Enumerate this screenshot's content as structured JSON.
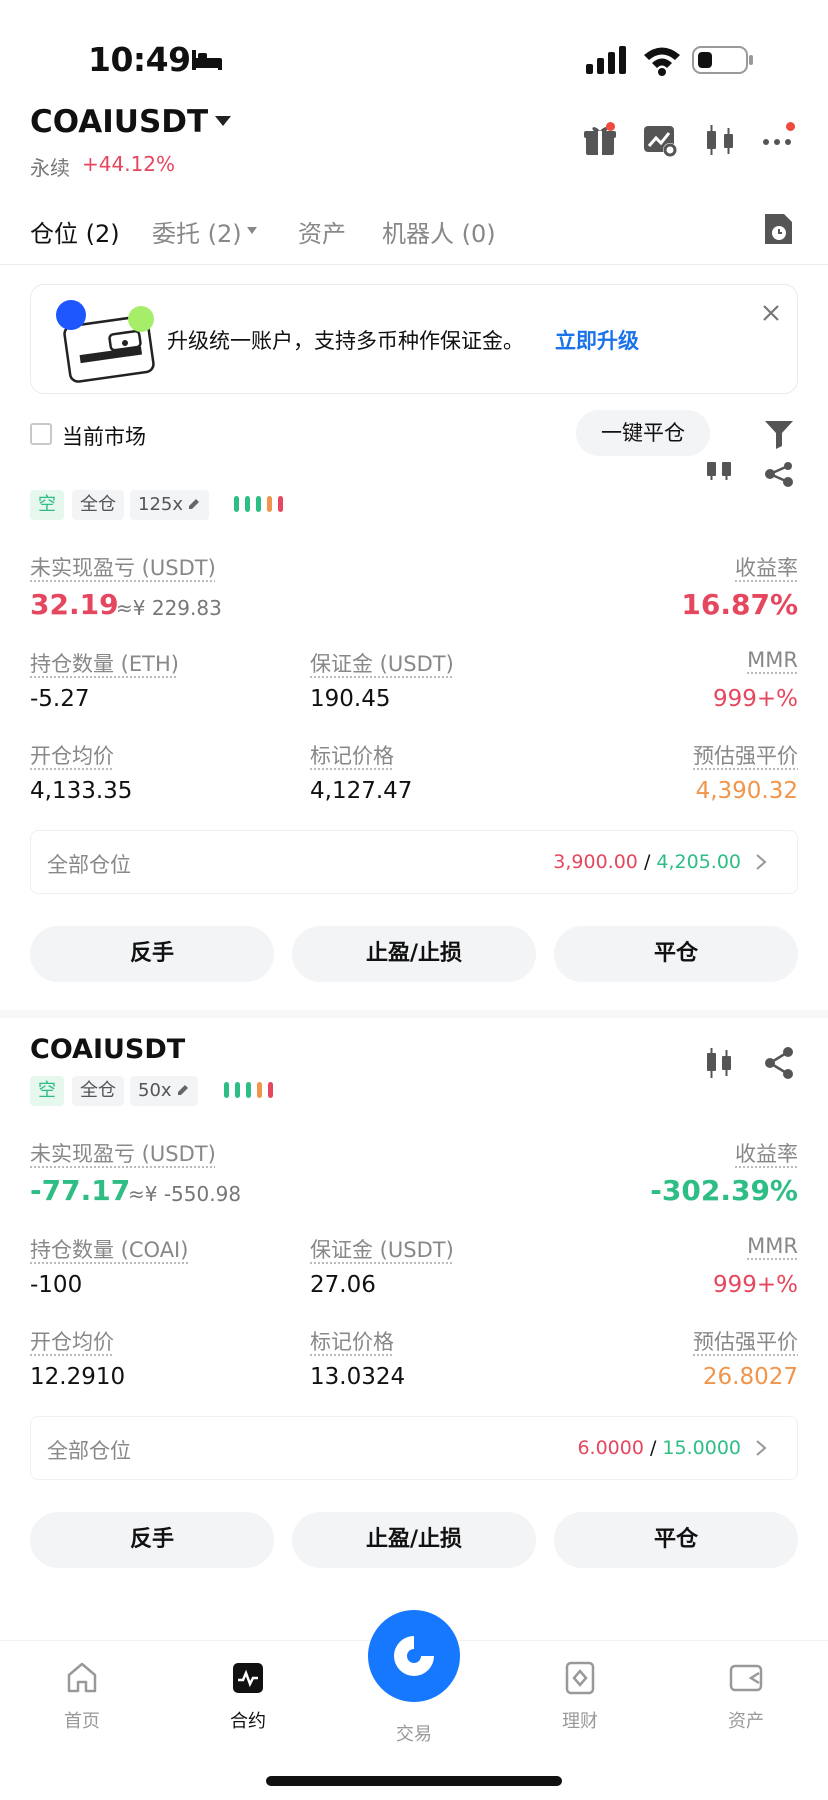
{
  "status_bar": {
    "time": "10:49"
  },
  "header": {
    "symbol": "COAIUSDT",
    "contract_type": "永续",
    "change": "+44.12%"
  },
  "tabs": [
    {
      "label": "仓位 (2)"
    },
    {
      "label": "委托 (2)"
    },
    {
      "label": "资产"
    },
    {
      "label": "机器人 (0)"
    }
  ],
  "banner": {
    "text": "升级统一账户，支持多币种作保证金。",
    "link": "立即升级"
  },
  "filter": {
    "current_market_label": "当前市场",
    "close_all_label": "一键平仓"
  },
  "positions": [
    {
      "title": "",
      "side": "空",
      "margin_mode": "全仓",
      "leverage": "125x",
      "pnl_label": "未实现盈亏 (USDT)",
      "pnl": "32.19",
      "pnl_cny": "≈¥ 229.83",
      "roi_label": "收益率",
      "roi": "16.87%",
      "qty_label": "持仓数量 (ETH)",
      "qty": "-5.27",
      "margin_label": "保证金 (USDT)",
      "margin": "190.45",
      "mmr_label": "MMR",
      "mmr": "999+%",
      "entry_label": "开仓均价",
      "entry": "4,133.35",
      "mark_label": "标记价格",
      "mark": "4,127.47",
      "liq_label": "预估强平价",
      "liq": "4,390.32",
      "tpsl_label": "全部仓位",
      "tp": "3,900.00",
      "sl": "4,205.00",
      "sep": "/",
      "btn_reverse": "反手",
      "btn_tpsl": "止盈/止损",
      "btn_close": "平仓",
      "pnl_color": "#e5475e"
    },
    {
      "title": "COAIUSDT",
      "side": "空",
      "margin_mode": "全仓",
      "leverage": "50x",
      "pnl_label": "未实现盈亏 (USDT)",
      "pnl": "-77.17",
      "pnl_cny": "≈¥ -550.98",
      "roi_label": "收益率",
      "roi": "-302.39%",
      "qty_label": "持仓数量 (COAI)",
      "qty": "-100",
      "margin_label": "保证金 (USDT)",
      "margin": "27.06",
      "mmr_label": "MMR",
      "mmr": "999+%",
      "entry_label": "开仓均价",
      "entry": "12.2910",
      "mark_label": "标记价格",
      "mark": "13.0324",
      "liq_label": "预估强平价",
      "liq": "26.8027",
      "tpsl_label": "全部仓位",
      "tp": "6.0000",
      "sl": "15.0000",
      "sep": "/",
      "btn_reverse": "反手",
      "btn_tpsl": "止盈/止损",
      "btn_close": "平仓",
      "pnl_color": "#2ebd85"
    }
  ],
  "bottom_nav": [
    {
      "label": "首页",
      "icon": "home-icon"
    },
    {
      "label": "合约",
      "icon": "futures-icon"
    },
    {
      "label": "交易",
      "icon": "trade-icon"
    },
    {
      "label": "理财",
      "icon": "earn-icon"
    },
    {
      "label": "资产",
      "icon": "wallet-icon"
    }
  ],
  "colors": {
    "profit": "#e5475e",
    "loss": "#2ebd85",
    "liq": "#f0954a",
    "brand": "#1677ff"
  }
}
